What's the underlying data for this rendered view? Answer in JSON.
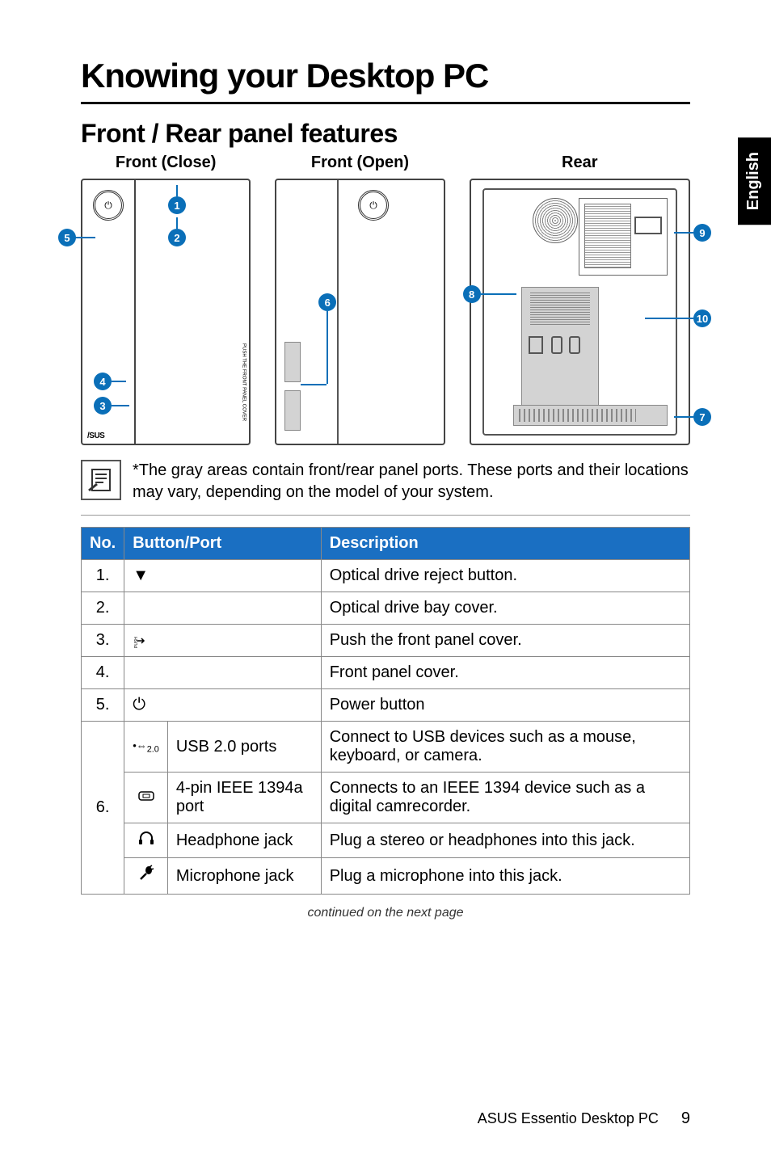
{
  "side_tab": "English",
  "headings": {
    "main": "Knowing your Desktop PC",
    "section": "Front / Rear panel features"
  },
  "diagrams": {
    "front_close_label": "Front (Close)",
    "front_open_label": "Front (Open)",
    "rear_label": "Rear",
    "asus": "/SUS",
    "push": "PUSH THE FRONT PANEL COVER"
  },
  "callouts": {
    "c1": "1",
    "c2": "2",
    "c3": "3",
    "c4": "4",
    "c5": "5",
    "c6": "6",
    "c7": "7",
    "c8": "8",
    "c9": "9",
    "c10": "10"
  },
  "note": "*The gray areas contain front/rear panel ports. These ports and their locations may vary, depending on the model of your system.",
  "table": {
    "headers": {
      "no": "No.",
      "bp": "Button/Port",
      "desc": "Description"
    },
    "r1": {
      "no": "1.",
      "icon": "▼",
      "desc": "Optical drive reject button."
    },
    "r2": {
      "no": "2.",
      "icon": "",
      "desc": "Optical drive bay cover."
    },
    "r3": {
      "no": "3.",
      "icon": "⤇",
      "desc": "Push the front panel cover."
    },
    "r4": {
      "no": "4.",
      "icon": "",
      "desc": "Front panel cover."
    },
    "r5": {
      "no": "5.",
      "icon": "⏻",
      "desc": "Power button"
    },
    "r6": {
      "no": "6.",
      "rows": [
        {
          "icon": "⟷2.0",
          "name": "USB 2.0 ports",
          "desc": "Connect to USB devices such as a mouse, keyboard, or camera."
        },
        {
          "icon": "⎚",
          "name": "4-pin IEEE 1394a port",
          "desc": "Connects to an IEEE 1394 device such as a digital camrecorder."
        },
        {
          "icon": "🎧",
          "name": "Headphone jack",
          "desc": "Plug a stereo or headphones into this jack."
        },
        {
          "icon": "🎤",
          "name": "Microphone jack",
          "desc": "Plug a microphone into this jack."
        }
      ]
    }
  },
  "continued": "continued on the next page",
  "footer": {
    "title": "ASUS Essentio Desktop PC",
    "page": "9"
  }
}
